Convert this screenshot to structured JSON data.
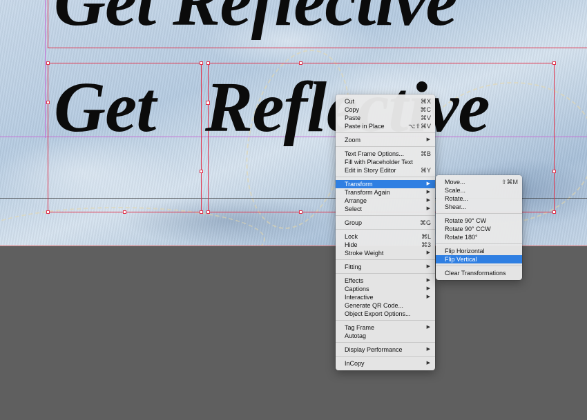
{
  "canvas": {
    "text_top": "Get Reflective",
    "text_word1": "Get",
    "text_word2": "Reflective"
  },
  "context_menu": {
    "sections": [
      [
        {
          "label": "Cut",
          "shortcut": "⌘X"
        },
        {
          "label": "Copy",
          "shortcut": "⌘C"
        },
        {
          "label": "Paste",
          "shortcut": "⌘V"
        },
        {
          "label": "Paste in Place",
          "shortcut": "⌥⇧⌘V"
        }
      ],
      [
        {
          "label": "Zoom",
          "submenu": true
        }
      ],
      [
        {
          "label": "Text Frame Options...",
          "shortcut": "⌘B"
        },
        {
          "label": "Fill with Placeholder Text"
        },
        {
          "label": "Edit in Story Editor",
          "shortcut": "⌘Y"
        }
      ],
      [
        {
          "label": "Transform",
          "submenu": true,
          "highlighted": true
        },
        {
          "label": "Transform Again",
          "submenu": true
        },
        {
          "label": "Arrange",
          "submenu": true
        },
        {
          "label": "Select",
          "submenu": true
        }
      ],
      [
        {
          "label": "Group",
          "shortcut": "⌘G"
        }
      ],
      [
        {
          "label": "Lock",
          "shortcut": "⌘L"
        },
        {
          "label": "Hide",
          "shortcut": "⌘3"
        },
        {
          "label": "Stroke Weight",
          "submenu": true
        }
      ],
      [
        {
          "label": "Fitting",
          "submenu": true
        }
      ],
      [
        {
          "label": "Effects",
          "submenu": true
        },
        {
          "label": "Captions",
          "submenu": true
        },
        {
          "label": "Interactive",
          "submenu": true
        },
        {
          "label": "Generate QR Code..."
        },
        {
          "label": "Object Export Options..."
        }
      ],
      [
        {
          "label": "Tag Frame",
          "submenu": true
        },
        {
          "label": "Autotag"
        }
      ],
      [
        {
          "label": "Display Performance",
          "submenu": true
        }
      ],
      [
        {
          "label": "InCopy",
          "submenu": true
        }
      ]
    ]
  },
  "transform_submenu": {
    "sections": [
      [
        {
          "label": "Move...",
          "shortcut": "⇧⌘M"
        },
        {
          "label": "Scale..."
        },
        {
          "label": "Rotate..."
        },
        {
          "label": "Shear..."
        }
      ],
      [
        {
          "label": "Rotate 90° CW"
        },
        {
          "label": "Rotate 90° CCW"
        },
        {
          "label": "Rotate 180°"
        }
      ],
      [
        {
          "label": "Flip Horizontal"
        },
        {
          "label": "Flip Vertical",
          "highlighted": true
        }
      ],
      [
        {
          "label": "Clear Transformations"
        }
      ]
    ]
  },
  "colors": {
    "highlight": "#2f7fe2",
    "frame": "#e0324b",
    "guide": "#c56fd6",
    "pasteboard": "#5f5f5f"
  }
}
